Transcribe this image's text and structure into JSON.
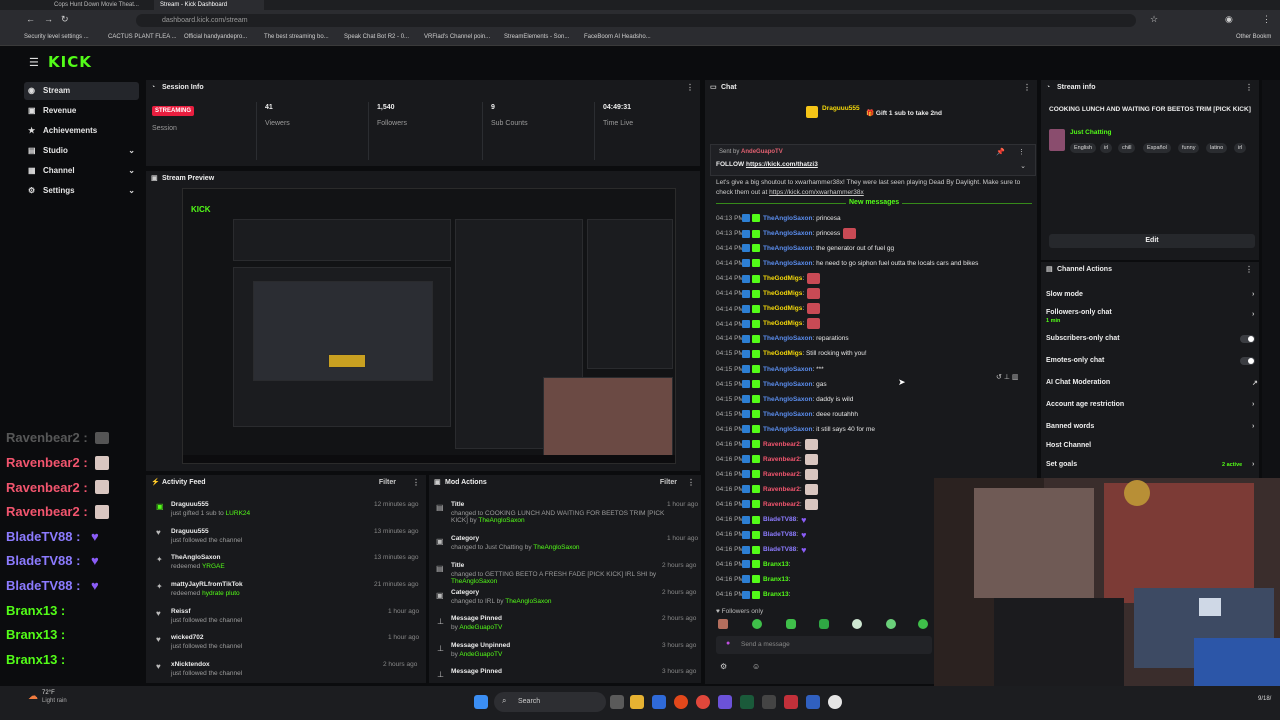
{
  "browser": {
    "tabs": [
      "Cops Hunt Down Movie Theat...",
      "Stream - Kick Dashboard"
    ],
    "url": "dashboard.kick.com/stream",
    "bookmarks": [
      "Security level settings ...",
      "CACTUS PLANT FLEA ...",
      "Official handyandepro...",
      "The best streaming bo...",
      "Speak Chat Bot R2 - 0...",
      "VRFlad's Channel poin...",
      "StreamElements - Son...",
      "FaceBoom AI Headsho...",
      "Other Bookm"
    ]
  },
  "app": {
    "logo": "KICK",
    "sidebar": [
      {
        "label": "Stream",
        "icon": "broadcast-icon",
        "active": true
      },
      {
        "label": "Revenue",
        "icon": "wallet-icon"
      },
      {
        "label": "Achievements",
        "icon": "trophy-icon"
      },
      {
        "label": "Studio",
        "icon": "studio-icon",
        "expandable": true
      },
      {
        "label": "Channel",
        "icon": "channel-icon",
        "expandable": true
      },
      {
        "label": "Settings",
        "icon": "gear-icon",
        "expandable": true
      }
    ]
  },
  "session": {
    "title": "Session Info",
    "badge": "STREAMING",
    "badge_label": "Session",
    "stats": [
      {
        "value": "41",
        "label": "Viewers"
      },
      {
        "value": "1,540",
        "label": "Followers"
      },
      {
        "value": "9",
        "label": "Sub Counts"
      },
      {
        "value": "04:49:31",
        "label": "Time Live"
      }
    ]
  },
  "preview": {
    "title": "Stream Preview",
    "overlay_names": [
      "Ravenbear2 :",
      "Ravenbear2 :",
      "Ravenbear2 :",
      "Ravenbear2 :",
      "BladeTV88 :",
      "BladeTV88 :",
      "BladeTV88 :",
      "Branx13 :",
      "Branx13 :",
      "Branx13 :"
    ]
  },
  "activity": {
    "title": "Activity Feed",
    "filter": "Filter",
    "items": [
      {
        "user": "Draguuu555",
        "sub": "just gifted 1 sub to ",
        "target": "LURK24",
        "time": "12 minutes ago"
      },
      {
        "user": "Draguuu555",
        "sub": "just followed the channel",
        "time": "13 minutes ago"
      },
      {
        "user": "TheAngloSaxon",
        "sub": "redeemed ",
        "target": "YRGAE",
        "time": "13 minutes ago"
      },
      {
        "user": "mattyJayRLfromTikTok",
        "sub": "redeemed ",
        "target": "hydrate pluto",
        "time": "21 minutes ago"
      },
      {
        "user": "Reissf",
        "sub": "just followed the channel",
        "time": "1 hour ago"
      },
      {
        "user": "wicked702",
        "sub": "just followed the channel",
        "time": "1 hour ago"
      },
      {
        "user": "xNicktendox",
        "sub": "just followed the channel",
        "time": "2 hours ago"
      }
    ]
  },
  "mod": {
    "title": "Mod Actions",
    "filter": "Filter",
    "items": [
      {
        "kind": "Title",
        "detail": "changed to COOKING LUNCH AND WAITING FOR BEETOS TRIM [PICK KICK] by",
        "by": "TheAngloSaxon",
        "time": "1 hour ago"
      },
      {
        "kind": "Category",
        "detail": "changed to Just Chatting by",
        "by": "TheAngloSaxon",
        "time": "1 hour ago"
      },
      {
        "kind": "Title",
        "detail": "changed to GETTING BEETO A FRESH FADE [PICK KICK] IRL SHI by",
        "by": "TheAngloSaxon",
        "time": "2 hours ago"
      },
      {
        "kind": "Category",
        "detail": "changed to IRL by",
        "by": "TheAngloSaxon",
        "time": "2 hours ago"
      },
      {
        "kind": "Message Pinned",
        "detail": "by",
        "by": "AndeGuapoTV",
        "time": "2 hours ago"
      },
      {
        "kind": "Message Unpinned",
        "detail": "by",
        "by": "AndeGuapoTV",
        "time": "3 hours ago"
      },
      {
        "kind": "Message Pinned",
        "detail": "",
        "by": "",
        "time": "3 hours ago"
      }
    ]
  },
  "chat": {
    "title": "Chat",
    "gifter": "Draguuu555",
    "gift_text": "Gift 1 sub to take 2nd",
    "pinned_sent_by": "Sent by",
    "pinned_by": "AndeGuapoTV",
    "pinned_text": "FOLLOW ",
    "pinned_link": "https://kick.com/thatzi3",
    "shoutout_text": "Let's give a big shoutout to xwarhammer38x! They were last seen playing Dead By Daylight. Make sure to check them out at",
    "shoutout_link": "https://kick.com/xwarhammer38x",
    "new_messages": "New messages",
    "messages": [
      {
        "time": "04:13 PM",
        "user": "TheAngloSaxon",
        "color": "blue",
        "text": ": princesa"
      },
      {
        "time": "04:13 PM",
        "user": "TheAngloSaxon",
        "color": "blue",
        "text": ": princess",
        "emote": true
      },
      {
        "time": "04:14 PM",
        "user": "TheAngloSaxon",
        "color": "blue",
        "text": ": the generator out of fuel gg"
      },
      {
        "time": "04:14 PM",
        "user": "TheAngloSaxon",
        "color": "blue",
        "text": ": he need to go siphon fuel outta the locals cars and bikes"
      },
      {
        "time": "04:14 PM",
        "user": "TheGodMigs",
        "color": "yellow",
        "text": ":",
        "emote": true
      },
      {
        "time": "04:14 PM",
        "user": "TheGodMigs",
        "color": "yellow",
        "text": ":",
        "emote": true
      },
      {
        "time": "04:14 PM",
        "user": "TheGodMigs",
        "color": "yellow",
        "text": ":",
        "emote": true
      },
      {
        "time": "04:14 PM",
        "user": "TheGodMigs",
        "color": "yellow",
        "text": ":",
        "emote": true
      },
      {
        "time": "04:14 PM",
        "user": "TheAngloSaxon",
        "color": "blue",
        "text": ": reparations"
      },
      {
        "time": "04:15 PM",
        "user": "TheGodMigs",
        "color": "yellow",
        "text": ": Still rocking with you!"
      },
      {
        "time": "04:15 PM",
        "user": "TheAngloSaxon",
        "color": "blue",
        "text": ": ***"
      },
      {
        "time": "04:15 PM",
        "user": "TheAngloSaxon",
        "color": "blue",
        "text": ": gas"
      },
      {
        "time": "04:15 PM",
        "user": "TheAngloSaxon",
        "color": "blue",
        "text": ": daddy is wild"
      },
      {
        "time": "04:15 PM",
        "user": "TheAngloSaxon",
        "color": "blue",
        "text": ": deee routahhh"
      },
      {
        "time": "04:16 PM",
        "user": "TheAngloSaxon",
        "color": "blue",
        "text": ": it still says 40 for me"
      },
      {
        "time": "04:16 PM",
        "user": "Ravenbear2",
        "color": "red",
        "text": ":",
        "emote": "pale"
      },
      {
        "time": "04:16 PM",
        "user": "Ravenbear2",
        "color": "red",
        "text": ":",
        "emote": "pale"
      },
      {
        "time": "04:16 PM",
        "user": "Ravenbear2",
        "color": "red",
        "text": ":",
        "emote": "pale"
      },
      {
        "time": "04:16 PM",
        "user": "Ravenbear2",
        "color": "red",
        "text": ":",
        "emote": "pale"
      },
      {
        "time": "04:16 PM",
        "user": "Ravenbear2",
        "color": "red",
        "text": ":",
        "emote": "pale"
      },
      {
        "time": "04:16 PM",
        "user": "BladeTV88",
        "color": "purple",
        "text": ":",
        "emote": "heart"
      },
      {
        "time": "04:16 PM",
        "user": "BladeTV88",
        "color": "purple",
        "text": ":",
        "emote": "heart"
      },
      {
        "time": "04:16 PM",
        "user": "BladeTV88",
        "color": "purple",
        "text": ":",
        "emote": "heart"
      },
      {
        "time": "04:16 PM",
        "user": "Branx13",
        "color": "green",
        "text": ":"
      },
      {
        "time": "04:16 PM",
        "user": "Branx13",
        "color": "green",
        "text": ":"
      },
      {
        "time": "04:16 PM",
        "user": "Branx13",
        "color": "green",
        "text": ":"
      }
    ],
    "followers_only": "Followers only",
    "input_placeholder": "Send a message"
  },
  "stream_info": {
    "title": "Stream info",
    "stream_title": "COOKING LUNCH AND WAITING FOR BEETOS TRIM [PICK KICK]",
    "category": "Just Chatting",
    "tags": [
      "English",
      "irl",
      "chill",
      "Español",
      "funny",
      "latino",
      "irl"
    ],
    "edit": "Edit"
  },
  "channel_actions": {
    "title": "Channel Actions",
    "items": [
      {
        "label": "Slow mode",
        "control": "chevron"
      },
      {
        "label": "Followers-only chat",
        "sub": "1 min",
        "control": "chevron"
      },
      {
        "label": "Subscribers-only chat",
        "control": "toggle"
      },
      {
        "label": "Emotes-only chat",
        "control": "toggle"
      },
      {
        "label": "AI Chat Moderation",
        "control": "external"
      },
      {
        "label": "Account age restriction",
        "control": "chevron"
      },
      {
        "label": "Banned words",
        "control": "chevron"
      },
      {
        "label": "Host Channel",
        "control": "none"
      },
      {
        "label": "Set goals",
        "status": "2 active",
        "control": "chevron"
      }
    ]
  },
  "taskbar": {
    "weather_temp": "72°F",
    "weather_desc": "Light rain",
    "search": "Search",
    "date": "9/18/"
  },
  "colors": {
    "kick_green": "#53fc18",
    "streaming_red": "#e91e3f",
    "user_blue": "#5b8ef0"
  }
}
